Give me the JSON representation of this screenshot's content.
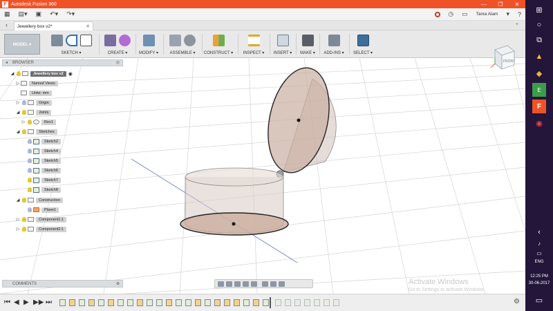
{
  "window": {
    "title": "Autodesk Fusion 360",
    "minimize": "—",
    "restore": "❐",
    "close": "✕"
  },
  "quickbar": {
    "user": "Tania Alam",
    "help": "?"
  },
  "document": {
    "tab_label": "Jewellery box v2*",
    "tab_close": "✕"
  },
  "ribbon": {
    "workspace": "MODEL ▾",
    "groups": {
      "sketch": "SKETCH ▾",
      "create": "CREATE ▾",
      "modify": "MODIFY ▾",
      "assemble": "ASSEMBLE ▾",
      "construct": "CONSTRUCT ▾",
      "inspect": "INSPECT ▾",
      "insert": "INSERT ▾",
      "make": "MAKE ▾",
      "addins": "ADD-INS ▾",
      "select": "SELECT ▾"
    }
  },
  "browser": {
    "header": "BROWSER",
    "root": "Jewellery box v2",
    "named_views": "Named Views",
    "units": "Units: mm",
    "origin": "Origin",
    "joints": "Joints",
    "rev1": "Rev1",
    "sketches": "Sketches",
    "sketch_items": [
      "Sketch2",
      "Sketch4",
      "Sketch5",
      "Sketch6",
      "Sketch7",
      "Sketch8"
    ],
    "construction": "Construction",
    "plane1": "Plane1",
    "component1": "Component1:1",
    "component2": "Component2:1"
  },
  "comments": {
    "label": "COMMENTS"
  },
  "viewcube": {
    "face": "FRONT"
  },
  "watermark": {
    "line1": "Activate Windows",
    "line2": "Go to Settings to activate Windows."
  },
  "taskbar": {
    "time": "12:25 PM",
    "date": "30-06-2017",
    "language": "ENG"
  },
  "colors": {
    "title_orange": "#f05228",
    "taskbar_purple": "#23163a",
    "model_body": "#b9a39a"
  }
}
